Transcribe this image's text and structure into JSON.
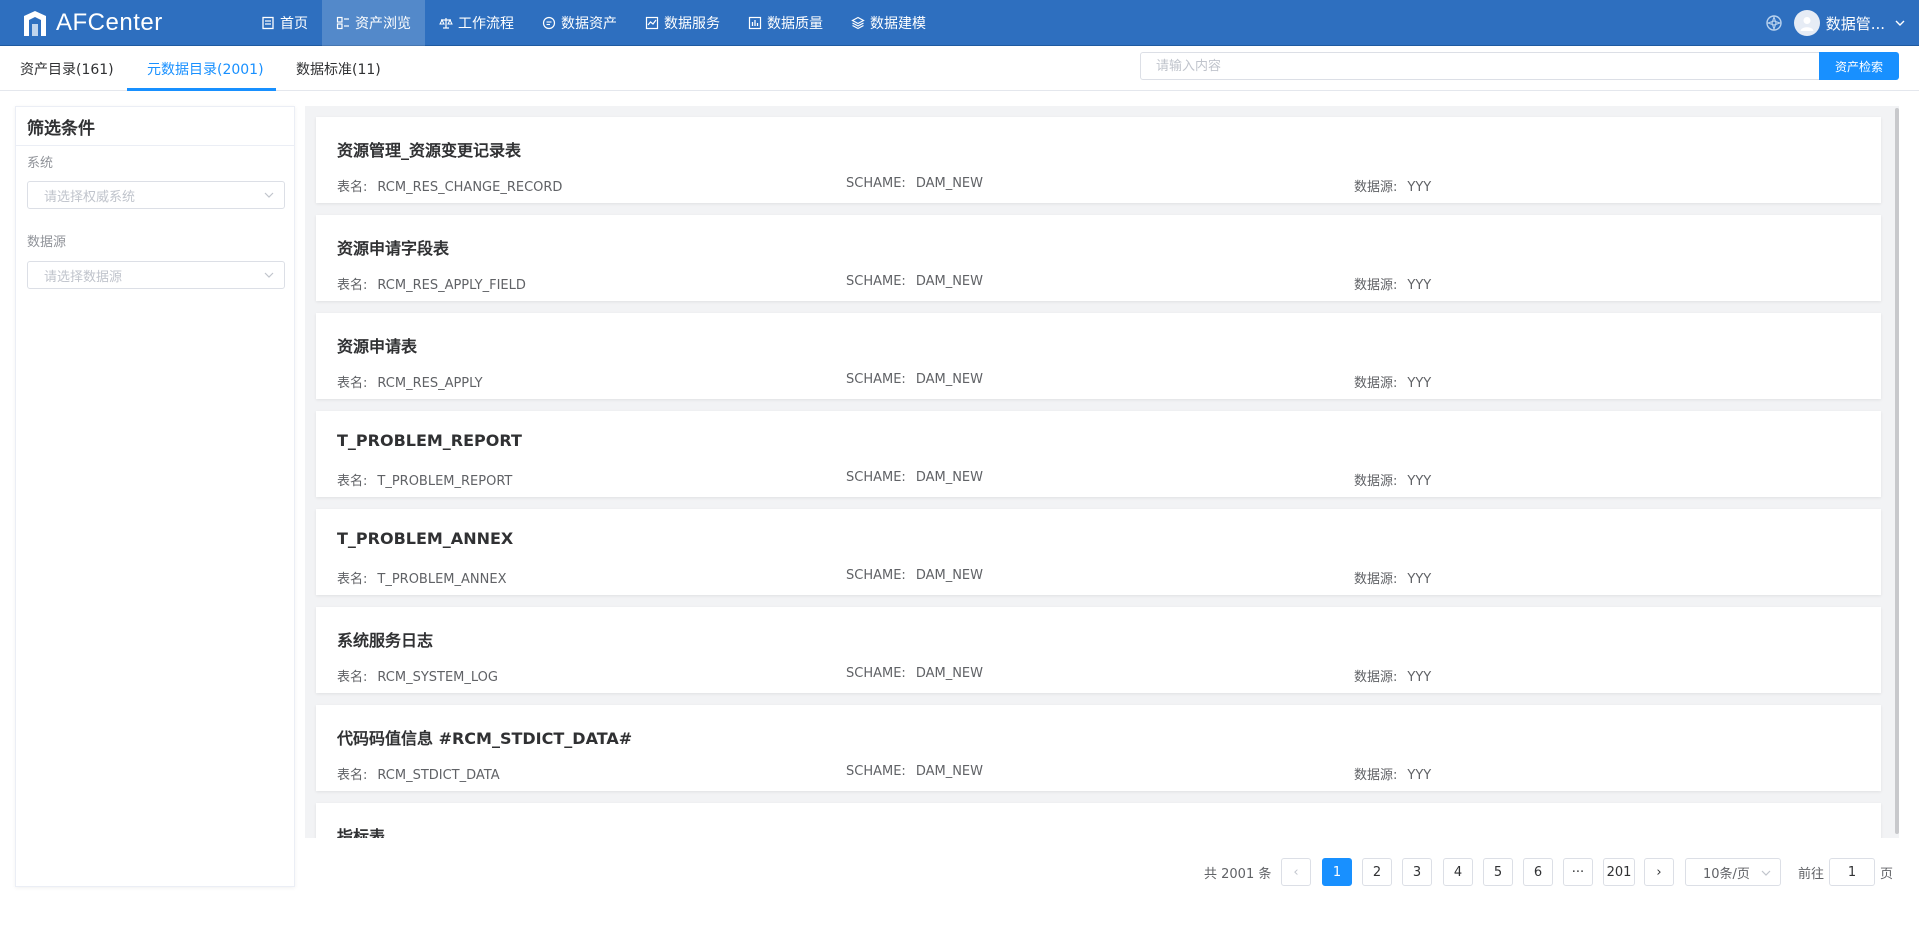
{
  "app": {
    "brand": "AFCenter"
  },
  "nav": [
    {
      "label": "首页",
      "icon": "document-icon"
    },
    {
      "label": "资产浏览",
      "icon": "grid-icon",
      "active": true
    },
    {
      "label": "工作流程",
      "icon": "scale-icon"
    },
    {
      "label": "数据资产",
      "icon": "chat-icon"
    },
    {
      "label": "数据服务",
      "icon": "chart-icon"
    },
    {
      "label": "数据质量",
      "icon": "bar-icon"
    },
    {
      "label": "数据建模",
      "icon": "layers-icon"
    }
  ],
  "user": {
    "name": "数据管..."
  },
  "tabs": [
    {
      "label": "资产目录(161)"
    },
    {
      "label": "元数据目录(2001)",
      "active": true
    },
    {
      "label": "数据标准(11)"
    }
  ],
  "search": {
    "placeholder": "请输入内容",
    "value": "",
    "button": "资产检索"
  },
  "filter": {
    "title": "筛选条件",
    "system_label": "系统",
    "system_placeholder": "请选择权威系统",
    "datasource_label": "数据源",
    "datasource_placeholder": "请选择数据源"
  },
  "meta_labels": {
    "table": "表名:",
    "schema": "SCHAME:",
    "datasource": "数据源:"
  },
  "results": [
    {
      "title": "资源管理_资源变更记录表",
      "table": "RCM_RES_CHANGE_RECORD",
      "schema": "DAM_NEW",
      "datasource": "YYY"
    },
    {
      "title": "资源申请字段表",
      "table": "RCM_RES_APPLY_FIELD",
      "schema": "DAM_NEW",
      "datasource": "YYY"
    },
    {
      "title": "资源申请表",
      "table": "RCM_RES_APPLY",
      "schema": "DAM_NEW",
      "datasource": "YYY"
    },
    {
      "title": "T_PROBLEM_REPORT",
      "table": "T_PROBLEM_REPORT",
      "schema": "DAM_NEW",
      "datasource": "YYY"
    },
    {
      "title": "T_PROBLEM_ANNEX",
      "table": "T_PROBLEM_ANNEX",
      "schema": "DAM_NEW",
      "datasource": "YYY"
    },
    {
      "title": "系统服务日志",
      "table": "RCM_SYSTEM_LOG",
      "schema": "DAM_NEW",
      "datasource": "YYY"
    },
    {
      "title": "代码码值信息 #RCM_STDICT_DATA#",
      "table": "RCM_STDICT_DATA",
      "schema": "DAM_NEW",
      "datasource": "YYY"
    },
    {
      "title": "指标表",
      "table": "",
      "schema": "",
      "datasource": ""
    }
  ],
  "pagination": {
    "total_text": "共 2001 条",
    "prev": "‹",
    "next": "›",
    "pages": [
      "1",
      "2",
      "3",
      "4",
      "5",
      "6",
      "···",
      "201"
    ],
    "current": "1",
    "page_size": "10条/页",
    "goto_label": "前往",
    "goto_value": "1",
    "goto_suffix": "页"
  },
  "colors": {
    "topbar": "#2e6fbf",
    "accent": "#1890ff"
  }
}
